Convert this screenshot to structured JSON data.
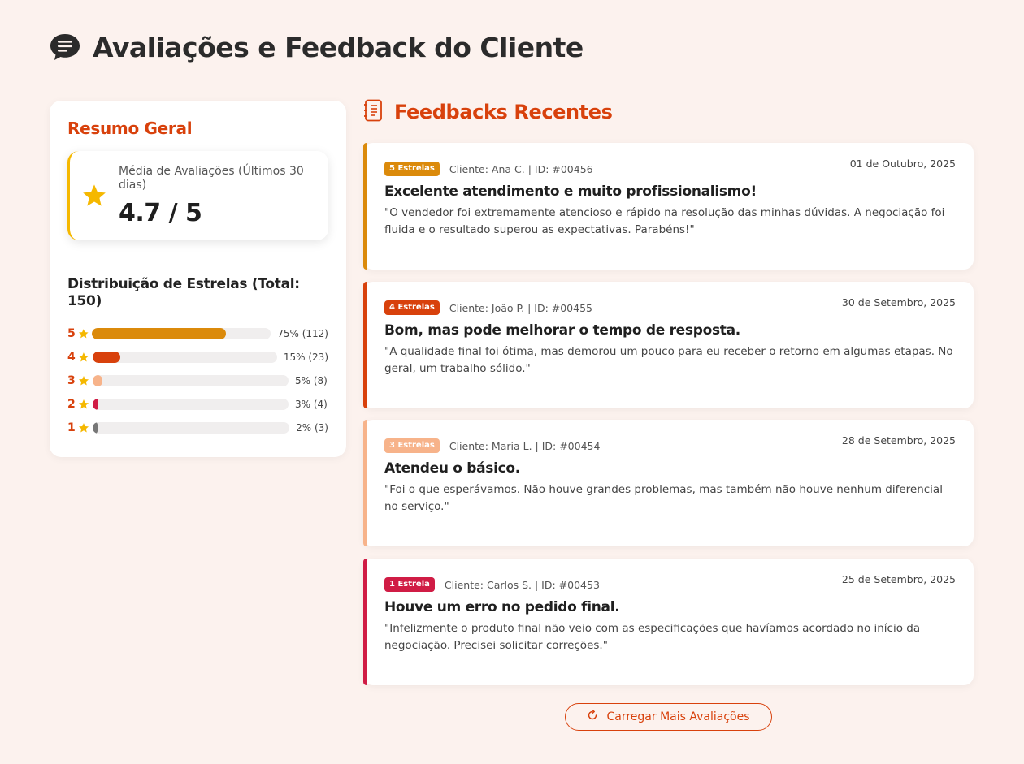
{
  "header": {
    "title": "Avaliações e Feedback do Cliente",
    "icon": "chat-bubble-icon"
  },
  "summary": {
    "title": "Resumo Geral",
    "avg_label": "Média de Avaliações (Últimos 30 dias)",
    "avg_value": "4.7 / 5",
    "dist_title": "Distribuição de Estrelas (Total: 150)",
    "rows": [
      {
        "stars": "5",
        "pct_text": "75% (112)",
        "fraction": 0.75,
        "color": "#db8a0b"
      },
      {
        "stars": "4",
        "pct_text": "15% (23)",
        "fraction": 0.15,
        "color": "#d8410c"
      },
      {
        "stars": "3",
        "pct_text": "5% (8)",
        "fraction": 0.05,
        "color": "#f7b38a"
      },
      {
        "stars": "2",
        "pct_text": "3% (4)",
        "fraction": 0.03,
        "color": "#d01c45"
      },
      {
        "stars": "1",
        "pct_text": "2% (3)",
        "fraction": 0.02,
        "color": "#777777"
      }
    ]
  },
  "feed": {
    "title": "Feedbacks Recentes",
    "icon": "notebook-icon",
    "cards": [
      {
        "badge": "5 Estrelas",
        "badge_color": "#db8a0b",
        "client": "Cliente: Ana C. | ID: #00456",
        "date": "01 de Outubro, 2025",
        "title": "Excelente atendimento e muito profissionalismo!",
        "text": "\"O vendedor foi extremamente atencioso e rápido na resolução das minhas dúvidas. A negociação foi fluida e o resultado superou as expectativas. Parabéns!\""
      },
      {
        "badge": "4 Estrelas",
        "badge_color": "#d8410c",
        "client": "Cliente: João P. | ID: #00455",
        "date": "30 de Setembro, 2025",
        "title": "Bom, mas pode melhorar o tempo de resposta.",
        "text": "\"A qualidade final foi ótima, mas demorou um pouco para eu receber o retorno em algumas etapas. No geral, um trabalho sólido.\""
      },
      {
        "badge": "3 Estrelas",
        "badge_color": "#f7b38a",
        "client": "Cliente: Maria L. | ID: #00454",
        "date": "28 de Setembro, 2025",
        "title": "Atendeu o básico.",
        "text": "\"Foi o que esperávamos. Não houve grandes problemas, mas também não houve nenhum diferencial no serviço.\""
      },
      {
        "badge": "1 Estrela",
        "badge_color": "#d01c45",
        "client": "Cliente: Carlos S. | ID: #00453",
        "date": "25 de Setembro, 2025",
        "title": "Houve um erro no pedido final.",
        "text": "\"Infelizmente o produto final não veio com as especificações que havíamos acordado no início da negociação. Precisei solicitar correções.\""
      }
    ]
  },
  "load_more": {
    "label": "Carregar Mais Avaliações",
    "icon": "refresh-icon"
  }
}
